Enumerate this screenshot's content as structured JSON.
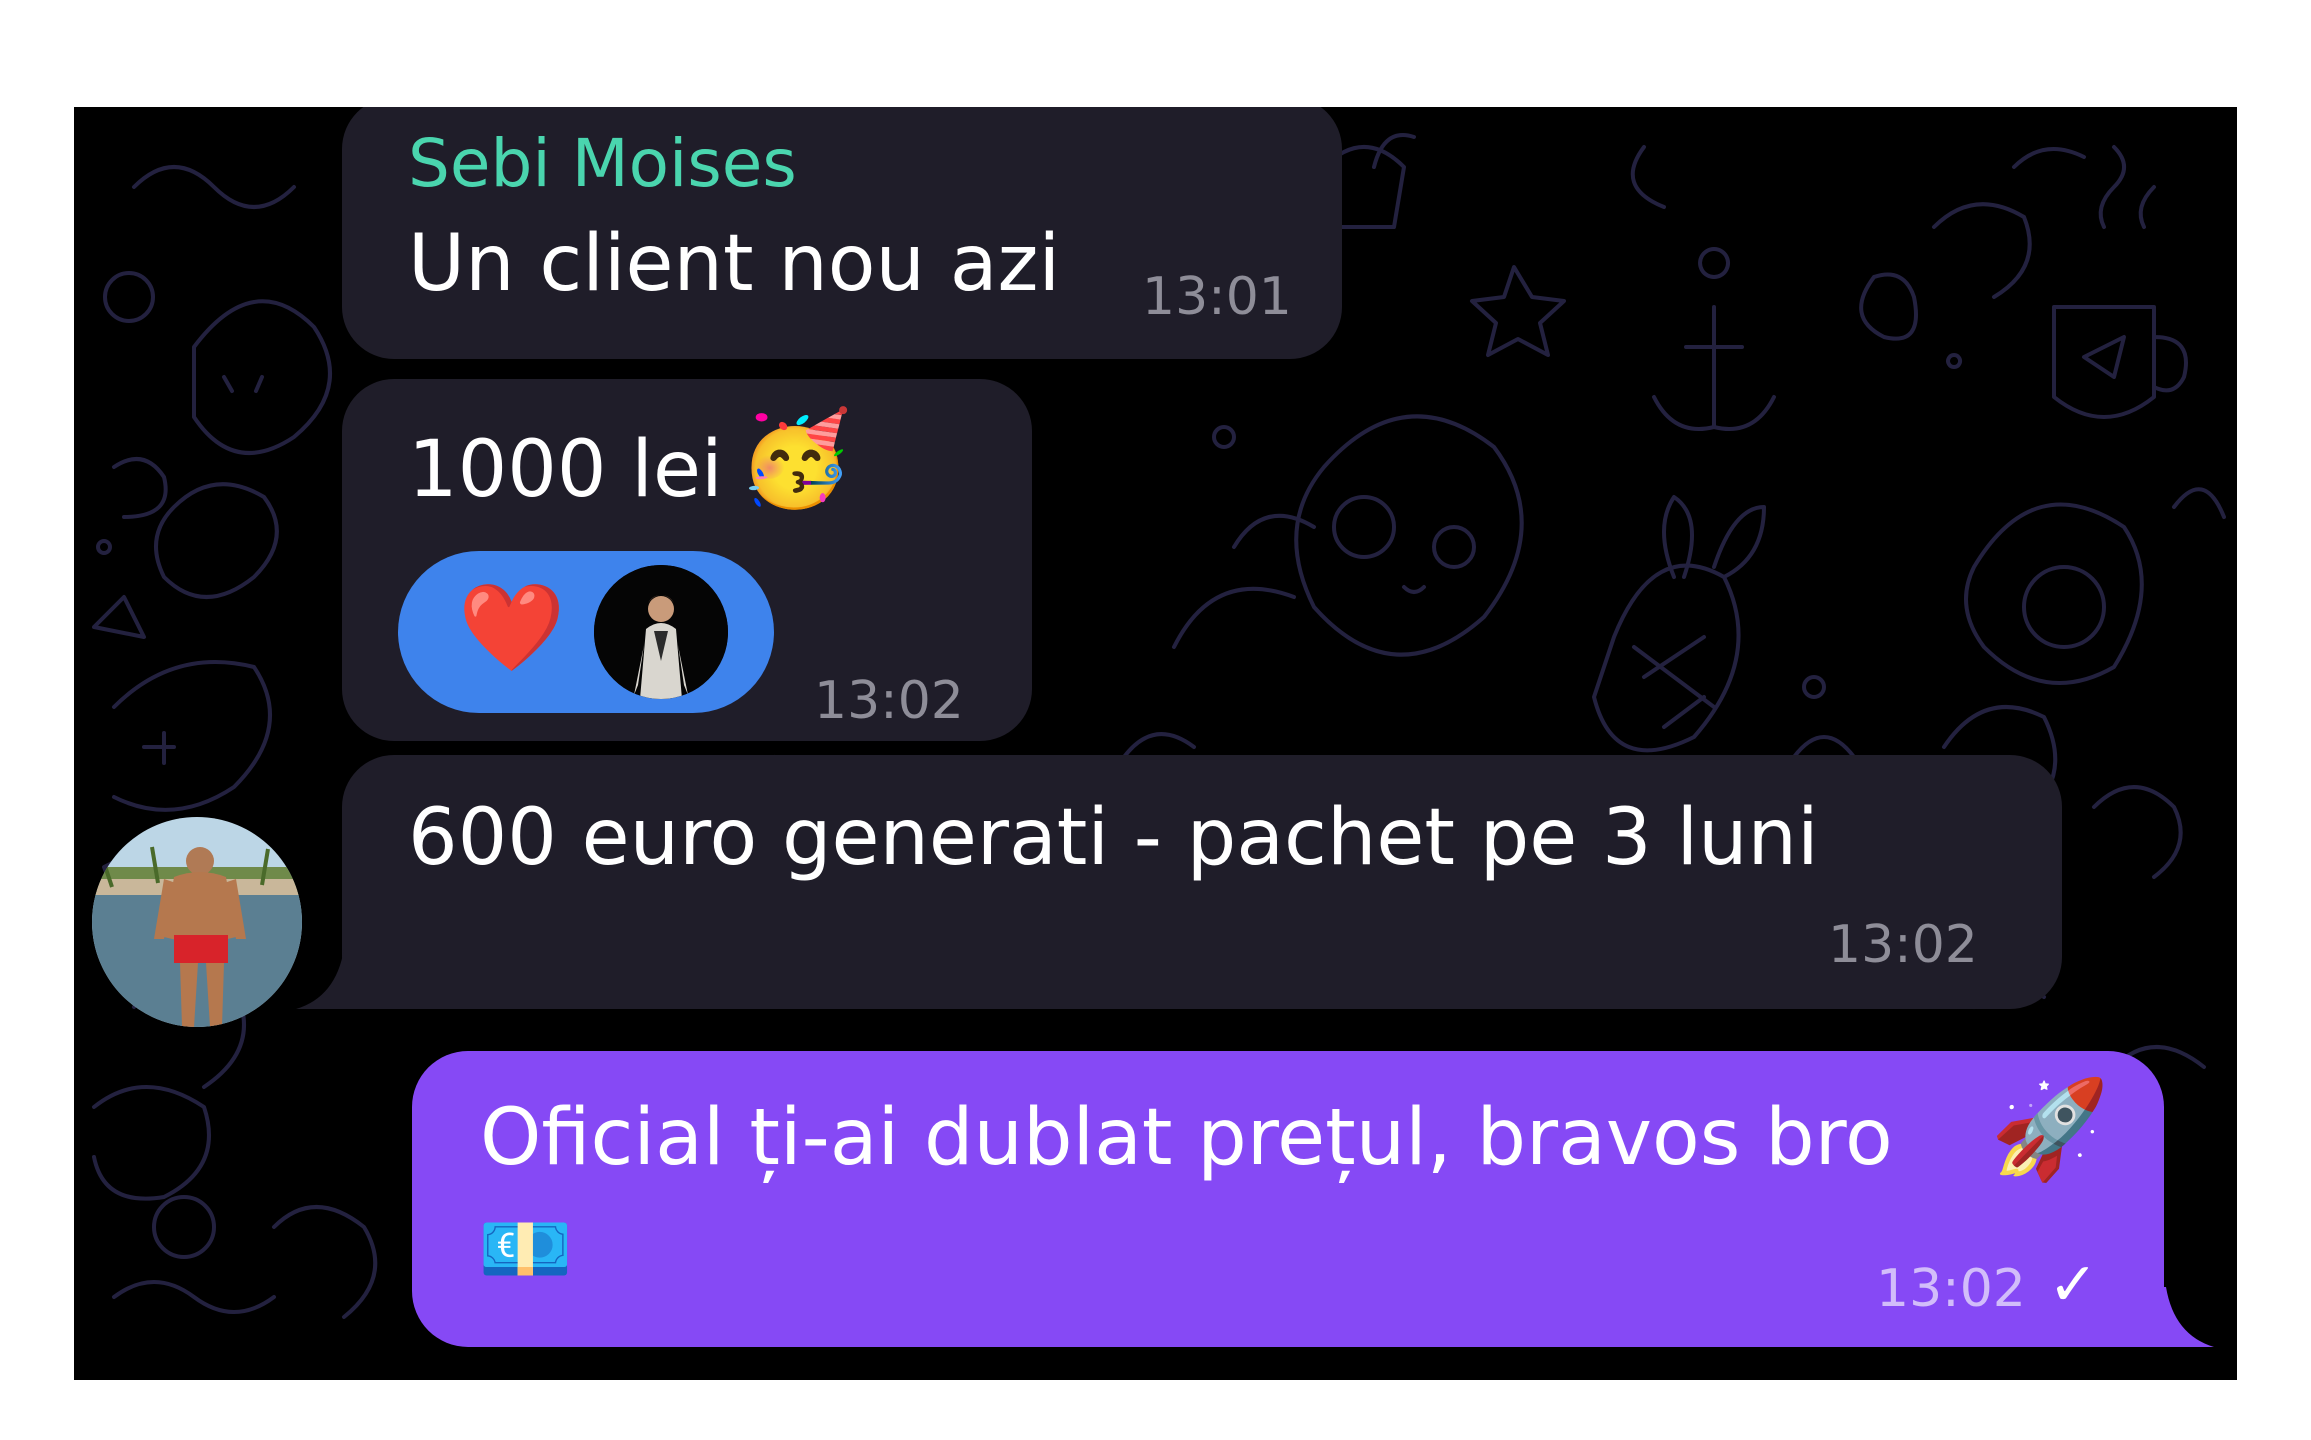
{
  "messages": [
    {
      "sender": "Sebi Moises",
      "text": "Un client nou azi",
      "time": "13:01"
    },
    {
      "text": "1000 lei",
      "emoji": "🥳",
      "reaction": "❤️",
      "time": "13:02"
    },
    {
      "text": "600 euro generati - pachet pe 3 luni",
      "time": "13:02"
    },
    {
      "text": "Oficial ți-ai dublat prețul, bravos bro",
      "emoji_rocket": "🚀",
      "emoji_money": "💶",
      "time": "13:02",
      "status": "✓"
    }
  ],
  "colors": {
    "incoming_bubble": "#1f1d29",
    "outgoing_bubble": "#8649f5",
    "sender_name": "#4ad5ae",
    "reaction_pill": "#3e83ec",
    "background": "#000000"
  },
  "icons": [
    "party-face-emoji",
    "heart-emoji",
    "rocket-emoji",
    "euro-banknote-emoji",
    "sent-check-icon"
  ]
}
